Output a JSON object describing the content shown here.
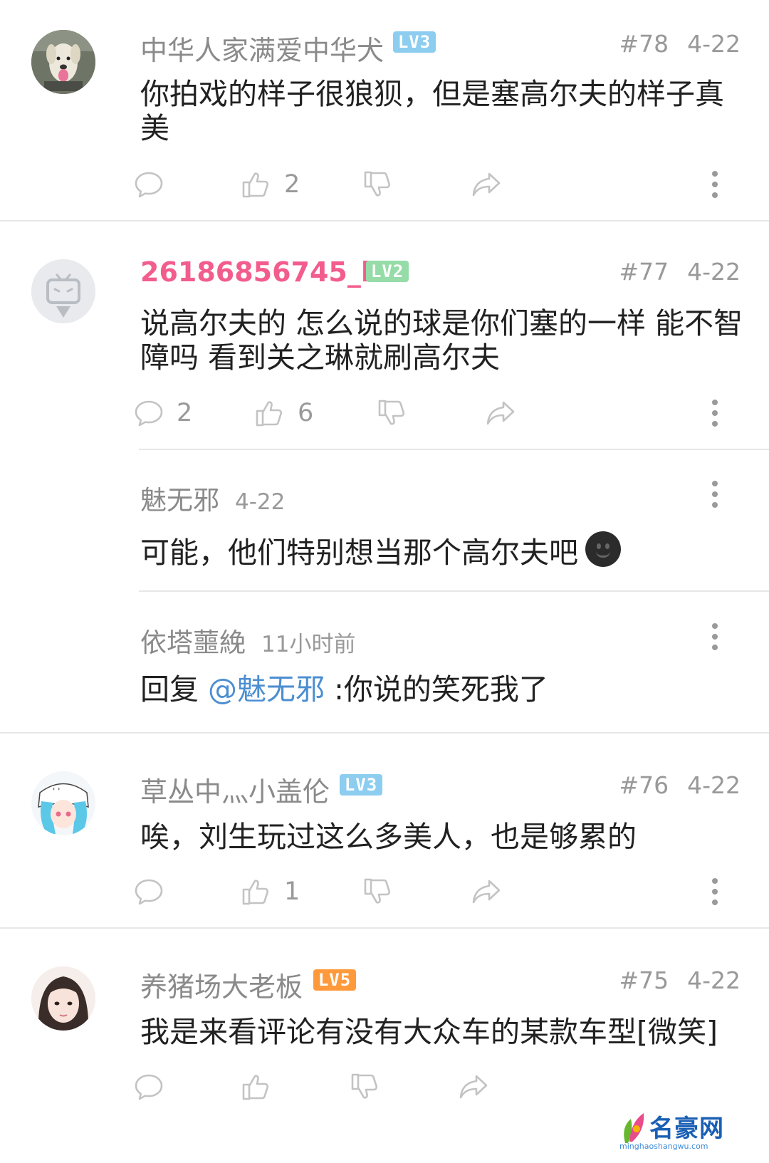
{
  "comments": [
    {
      "user": "中华人家满爱中华犬",
      "level": "LV3",
      "floor": "#78",
      "date": "4-22",
      "text": "你拍戏的样子很狼狈，但是塞高尔夫的样子真美",
      "reply_count": "",
      "like_count": "2"
    },
    {
      "user": "26186856745_bili",
      "level": "LV2",
      "floor": "#77",
      "date": "4-22",
      "text": "说高尔夫的 怎么说的球是你们塞的一样 能不智障吗 看到关之琳就刷高尔夫",
      "reply_count": "2",
      "like_count": "6",
      "replies": [
        {
          "user": "魅无邪",
          "time": "4-22",
          "text": "可能，他们特别想当那个高尔夫吧"
        },
        {
          "user": "依塔蘁絻",
          "time": "11小时前",
          "prefix": "回复 ",
          "mention": "@魅无邪",
          "text": " :你说的笑死我了"
        }
      ]
    },
    {
      "user": "草丛中灬小盖伦",
      "level": "LV3",
      "floor": "#76",
      "date": "4-22",
      "text": "唉，刘生玩过这么多美人，也是够累的",
      "reply_count": "",
      "like_count": "1"
    },
    {
      "user": "养猪场大老板",
      "level": "LV5",
      "floor": "#75",
      "date": "4-22",
      "text": "我是来看评论有没有大众车的某款车型[微笑]",
      "reply_count": "",
      "like_count": ""
    }
  ],
  "icons": {
    "reply": "speech-bubble-icon",
    "like": "thumbs-up-icon",
    "dislike": "thumbs-down-icon",
    "share": "share-arrow-icon",
    "more": "vertical-dots-icon"
  },
  "watermark": {
    "name": "名豪网",
    "url": "minghaoshangwu.com"
  },
  "colors": {
    "pink_name": "#f25d8e",
    "mention": "#4c8ed1",
    "lv3": "#8ccdf0",
    "lv2": "#95dca8",
    "lv5": "#ff9a3c"
  }
}
